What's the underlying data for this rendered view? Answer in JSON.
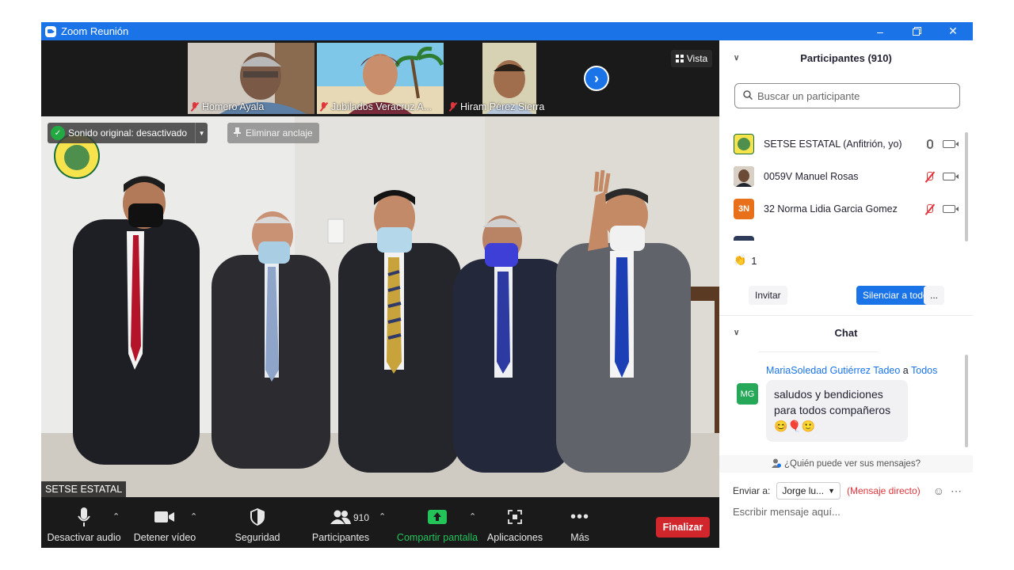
{
  "window": {
    "title": "Zoom Reunión"
  },
  "gallery": {
    "thumbs": [
      {
        "name": "Homero Ayala"
      },
      {
        "name": "Jubilados Veracruz A..."
      },
      {
        "name": "Hiram Pérez Sierra"
      }
    ],
    "view_label": "Vista"
  },
  "main_video": {
    "original_sound": "Sonido original: desactivado",
    "unpin_label": "Eliminar anclaje",
    "speaker_name": "SETSE ESTATAL"
  },
  "toolbar": {
    "mute_label": "Desactivar audio",
    "video_label": "Detener vídeo",
    "security_label": "Seguridad",
    "participants_label": "Participantes",
    "participants_count": "910",
    "share_label": "Compartir pantalla",
    "apps_label": "Aplicaciones",
    "more_label": "Más",
    "end_label": "Finalizar"
  },
  "participants_panel": {
    "title": "Participantes (910)",
    "search_placeholder": "Buscar un participante",
    "rows": [
      {
        "name": "SETSE ESTATAL (Anfitrión, yo)",
        "initials": "",
        "muted": false
      },
      {
        "name": "0059V Manuel Rosas",
        "initials": "",
        "muted": true
      },
      {
        "name": "32 Norma Lidia Garcia Gomez",
        "initials": "3N",
        "muted": true
      }
    ],
    "reaction_count": "1",
    "invite_label": "Invitar",
    "mute_all_label": "Silenciar a todos",
    "more_label": "..."
  },
  "chat_panel": {
    "title": "Chat",
    "message": {
      "sender": "MariaSoledad Gutiérrez Tadeo",
      "connector": "a",
      "recipient": "Todos",
      "initials": "MG",
      "text_line1": "saludos y bendiciones",
      "text_line2": "para todos compañeros",
      "emojis": "😊🎈🙂"
    },
    "who_can_see": "¿Quién puede ver sus mensajes?",
    "send_to_label": "Enviar a:",
    "send_to_value": "Jorge lu...",
    "direct_message": "(Mensaje directo)",
    "input_placeholder": "Escribir mensaje aquí..."
  },
  "colors": {
    "accent": "#1a74e8",
    "end": "#d0262c",
    "share": "#23c35a",
    "muted": "#e0353b"
  }
}
